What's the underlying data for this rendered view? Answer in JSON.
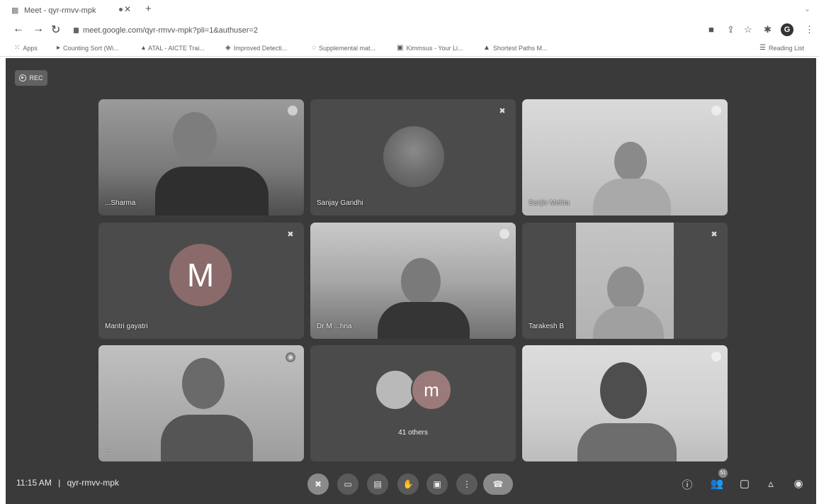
{
  "browser": {
    "tab_title": "Meet - qyr-rmvv-mpk",
    "url": "meet.google.com/qyr-rmvv-mpk?pli=1&authuser=2",
    "bookmarks": [
      {
        "label": "Apps",
        "icon": "grid-icon"
      },
      {
        "label": "Counting Sort (Wi...",
        "icon": "bookmark-icon"
      },
      {
        "label": "ATAL - AICTE Trai...",
        "icon": "bookmark-icon"
      },
      {
        "label": "Improved Detecti...",
        "icon": "bookmark-icon"
      },
      {
        "label": "Supplemental mat...",
        "icon": "bookmark-icon"
      },
      {
        "label": "Kimmsus - Your Li...",
        "icon": "bookmark-icon"
      },
      {
        "label": "Shortest Paths M...",
        "icon": "bookmark-icon"
      }
    ],
    "reading_list": "Reading List",
    "profile_initial": "G"
  },
  "meet": {
    "rec_label": "REC",
    "participants": [
      {
        "name": "...Sharma"
      },
      {
        "name": "Sanjay Gandhi"
      },
      {
        "name": "Sanjiv Mehta"
      },
      {
        "name": "Mantri gayatri",
        "avatar_letter": "M"
      },
      {
        "name": "Dr M ...hna"
      },
      {
        "name": "Tarakesh B"
      },
      {
        "name": "..."
      },
      {
        "others_label": "41 others",
        "avatar_letter": "m"
      },
      {
        "name": ""
      }
    ],
    "time": "11:15 AM",
    "separator": "|",
    "meeting_code": "qyr-rmvv-mpk",
    "people_count": "51"
  },
  "colors": {
    "meet_background": "#3a3a3a",
    "tile_background": "#4b4b4b"
  }
}
